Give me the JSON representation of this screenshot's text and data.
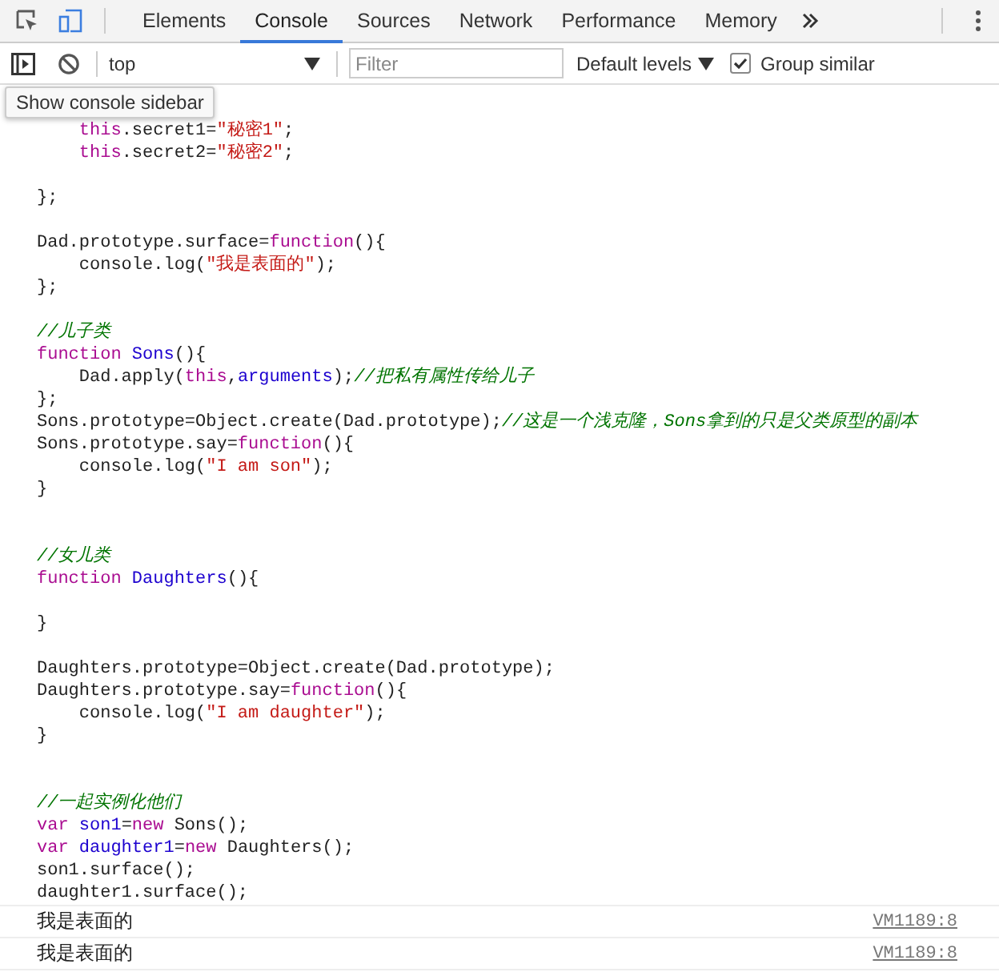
{
  "tabs": [
    {
      "label": "Elements",
      "selected": false
    },
    {
      "label": "Console",
      "selected": true
    },
    {
      "label": "Sources",
      "selected": false
    },
    {
      "label": "Network",
      "selected": false
    },
    {
      "label": "Performance",
      "selected": false
    },
    {
      "label": "Memory",
      "selected": false
    }
  ],
  "toolbar": {
    "context": "top",
    "filter": {
      "placeholder": "Filter"
    },
    "levels": "Default levels",
    "group_similar": {
      "label": "Group similar",
      "checked": true
    }
  },
  "tooltip": "Show console sidebar",
  "code_lines": [
    {
      "kind": "code",
      "tokens": [
        {
          "kind": "keyword",
          "text": "    this"
        },
        {
          "kind": "plain",
          "text": ".secret1="
        },
        {
          "kind": "string",
          "text": "\"秘密1\""
        },
        {
          "kind": "plain",
          "text": ";"
        }
      ]
    },
    {
      "kind": "code",
      "tokens": [
        {
          "kind": "keyword",
          "text": "    this"
        },
        {
          "kind": "plain",
          "text": ".secret2="
        },
        {
          "kind": "string",
          "text": "\"秘密2\""
        },
        {
          "kind": "plain",
          "text": ";"
        }
      ]
    },
    {
      "kind": "blank"
    },
    {
      "kind": "code",
      "tokens": [
        {
          "kind": "plain",
          "text": "};"
        }
      ]
    },
    {
      "kind": "blank"
    },
    {
      "kind": "code",
      "tokens": [
        {
          "kind": "plain",
          "text": "Dad.prototype.surface="
        },
        {
          "kind": "keyword",
          "text": "function"
        },
        {
          "kind": "plain",
          "text": "(){"
        }
      ]
    },
    {
      "kind": "code",
      "tokens": [
        {
          "kind": "plain",
          "text": "    console.log("
        },
        {
          "kind": "string",
          "text": "\"我是表面的\""
        },
        {
          "kind": "plain",
          "text": ");"
        }
      ]
    },
    {
      "kind": "code",
      "tokens": [
        {
          "kind": "plain",
          "text": "};"
        }
      ]
    },
    {
      "kind": "blank"
    },
    {
      "kind": "code",
      "tokens": [
        {
          "kind": "comment",
          "text": "//儿子类"
        }
      ]
    },
    {
      "kind": "code",
      "tokens": [
        {
          "kind": "keyword",
          "text": "function "
        },
        {
          "kind": "name",
          "text": "Sons"
        },
        {
          "kind": "plain",
          "text": "(){"
        }
      ]
    },
    {
      "kind": "code",
      "tokens": [
        {
          "kind": "plain",
          "text": "    Dad.apply("
        },
        {
          "kind": "keyword",
          "text": "this"
        },
        {
          "kind": "plain",
          "text": ","
        },
        {
          "kind": "name",
          "text": "arguments"
        },
        {
          "kind": "plain",
          "text": ");"
        },
        {
          "kind": "comment",
          "text": "//把私有属性传给儿子"
        }
      ]
    },
    {
      "kind": "code",
      "tokens": [
        {
          "kind": "plain",
          "text": "};"
        }
      ]
    },
    {
      "kind": "code",
      "tokens": [
        {
          "kind": "plain",
          "text": "Sons.prototype=Object.create(Dad.prototype);"
        },
        {
          "kind": "comment",
          "text": "//这是一个浅克隆，Sons拿到的只是父类原型的副本"
        }
      ]
    },
    {
      "kind": "code",
      "tokens": [
        {
          "kind": "plain",
          "text": "Sons.prototype.say="
        },
        {
          "kind": "keyword",
          "text": "function"
        },
        {
          "kind": "plain",
          "text": "(){"
        }
      ]
    },
    {
      "kind": "code",
      "tokens": [
        {
          "kind": "plain",
          "text": "    console.log("
        },
        {
          "kind": "string",
          "text": "\"I am son\""
        },
        {
          "kind": "plain",
          "text": ");"
        }
      ]
    },
    {
      "kind": "code",
      "tokens": [
        {
          "kind": "plain",
          "text": "}"
        }
      ]
    },
    {
      "kind": "blank"
    },
    {
      "kind": "blank"
    },
    {
      "kind": "code",
      "tokens": [
        {
          "kind": "comment",
          "text": "//女儿类"
        }
      ]
    },
    {
      "kind": "code",
      "tokens": [
        {
          "kind": "keyword",
          "text": "function "
        },
        {
          "kind": "name",
          "text": "Daughters"
        },
        {
          "kind": "plain",
          "text": "(){"
        }
      ]
    },
    {
      "kind": "blank"
    },
    {
      "kind": "code",
      "tokens": [
        {
          "kind": "plain",
          "text": "}"
        }
      ]
    },
    {
      "kind": "blank"
    },
    {
      "kind": "code",
      "tokens": [
        {
          "kind": "plain",
          "text": "Daughters.prototype=Object.create(Dad.prototype);"
        }
      ]
    },
    {
      "kind": "code",
      "tokens": [
        {
          "kind": "plain",
          "text": "Daughters.prototype.say="
        },
        {
          "kind": "keyword",
          "text": "function"
        },
        {
          "kind": "plain",
          "text": "(){"
        }
      ]
    },
    {
      "kind": "code",
      "tokens": [
        {
          "kind": "plain",
          "text": "    console.log("
        },
        {
          "kind": "string",
          "text": "\"I am daughter\""
        },
        {
          "kind": "plain",
          "text": ");"
        }
      ]
    },
    {
      "kind": "code",
      "tokens": [
        {
          "kind": "plain",
          "text": "}"
        }
      ]
    },
    {
      "kind": "blank"
    },
    {
      "kind": "blank"
    },
    {
      "kind": "code",
      "tokens": [
        {
          "kind": "comment",
          "text": "//一起实例化他们"
        }
      ]
    },
    {
      "kind": "code",
      "tokens": [
        {
          "kind": "keyword",
          "text": "var "
        },
        {
          "kind": "name",
          "text": "son1"
        },
        {
          "kind": "plain",
          "text": "="
        },
        {
          "kind": "keyword",
          "text": "new"
        },
        {
          "kind": "plain",
          "text": " Sons();"
        }
      ]
    },
    {
      "kind": "code",
      "tokens": [
        {
          "kind": "keyword",
          "text": "var "
        },
        {
          "kind": "name",
          "text": "daughter1"
        },
        {
          "kind": "plain",
          "text": "="
        },
        {
          "kind": "keyword",
          "text": "new"
        },
        {
          "kind": "plain",
          "text": " Daughters();"
        }
      ]
    },
    {
      "kind": "code",
      "tokens": [
        {
          "kind": "plain",
          "text": "son1.surface();"
        }
      ]
    },
    {
      "kind": "code",
      "tokens": [
        {
          "kind": "plain",
          "text": "daughter1.surface();"
        }
      ]
    }
  ],
  "messages": [
    {
      "text": "我是表面的",
      "source": "VM1189:8"
    },
    {
      "text": "我是表面的",
      "source": "VM1189:8"
    }
  ]
}
